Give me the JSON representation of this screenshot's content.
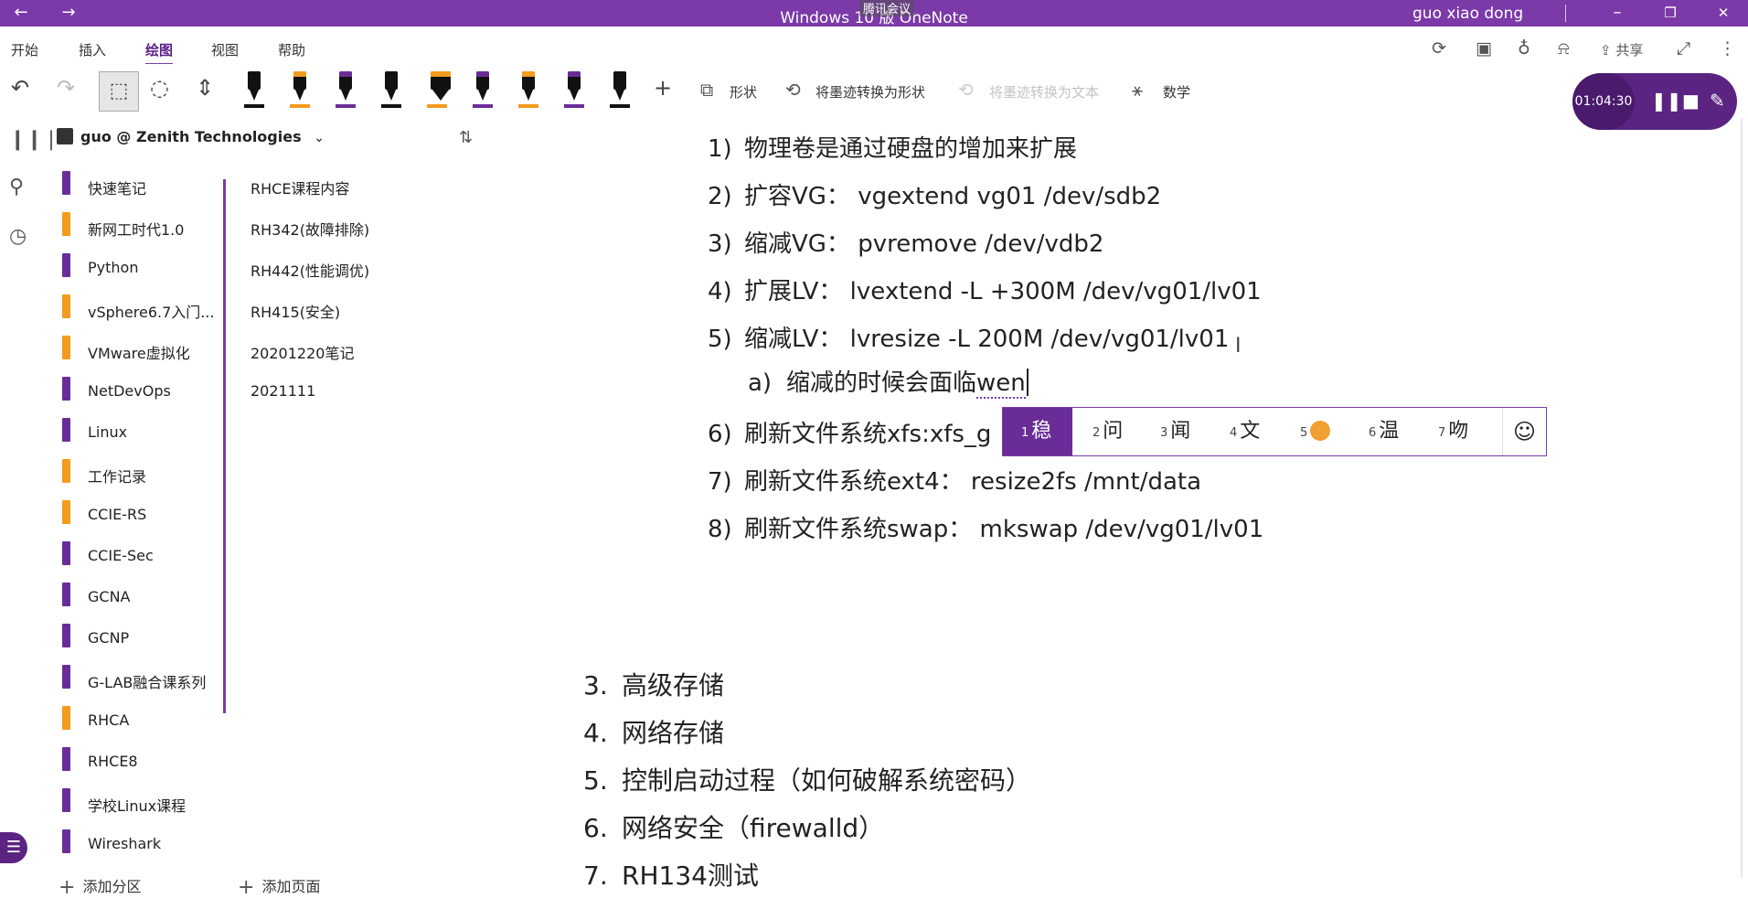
{
  "titlebar": {
    "title": "Windows 10 版 OneNote",
    "meeting_label": "腾讯会议",
    "user": "guo xiao dong",
    "back_icon": "←",
    "forward_icon": "→",
    "minimize_icon": "–",
    "restore_icon": "❐",
    "close_icon": "✕"
  },
  "menu": {
    "tabs": [
      "开始",
      "插入",
      "绘图",
      "视图",
      "帮助"
    ],
    "active_tab": "绘图",
    "share_label": "共享"
  },
  "ribbon": {
    "shapes_label": "形状",
    "ink_to_shape_label": "将墨迹转换为形状",
    "ink_to_text_label": "将墨迹转换为文本",
    "math_label": "数学",
    "pen_colors": [
      "#111111",
      "#f39b1e",
      "#6a2d97",
      "#111111",
      "#f39b1e",
      "#6a2d97",
      "#f39b1e",
      "#6a2d97",
      "#111111"
    ]
  },
  "timer": {
    "elapsed": "01:04:30"
  },
  "notebook": {
    "name": "guo @ Zenith Technologies",
    "sections": [
      {
        "name": "快速笔记",
        "color": "#6a2d97"
      },
      {
        "name": "新网工时代1.0",
        "color": "#f39b1e"
      },
      {
        "name": "Python",
        "color": "#6a2d97"
      },
      {
        "name": "vSphere6.7入门...",
        "color": "#f39b1e"
      },
      {
        "name": "VMware虚拟化",
        "color": "#f39b1e"
      },
      {
        "name": "NetDevOps",
        "color": "#6a2d97"
      },
      {
        "name": "Linux",
        "color": "#6a2d97"
      },
      {
        "name": "工作记录",
        "color": "#f39b1e"
      },
      {
        "name": "CCIE-RS",
        "color": "#f39b1e"
      },
      {
        "name": "CCIE-Sec",
        "color": "#6a2d97"
      },
      {
        "name": "GCNA",
        "color": "#6a2d97"
      },
      {
        "name": "GCNP",
        "color": "#6a2d97"
      },
      {
        "name": "G-LAB融合课系列",
        "color": "#6a2d97"
      },
      {
        "name": "RHCA",
        "color": "#f39b1e"
      },
      {
        "name": "RHCE8",
        "color": "#6a2d97"
      },
      {
        "name": "学校Linux课程",
        "color": "#6a2d97"
      },
      {
        "name": "Wireshark",
        "color": "#6a2d97"
      }
    ],
    "pages": [
      "RHCE课程内容",
      "RH342(故障排除)",
      "RH442(性能调优)",
      "RH415(安全)",
      "20201220笔记",
      "2021111"
    ],
    "add_section_label": "添加分区",
    "add_page_label": "添加页面"
  },
  "note": {
    "lines": [
      {
        "num": "1)",
        "text": "物理卷是通过硬盘的增加来扩展"
      },
      {
        "num": "2)",
        "text": "扩容VG： vgextend vg01 /dev/sdb2"
      },
      {
        "num": "3)",
        "text": "缩减VG： pvremove /dev/vdb2"
      },
      {
        "num": "4)",
        "text": "扩展LV： lvextend -L +300M /dev/vg01/lv01"
      },
      {
        "num": "5)",
        "text": "缩减LV： lvresize -L 200M /dev/vg01/lv01"
      },
      {
        "num": "6)",
        "text": "刷新文件系统xfs:xfs_g"
      },
      {
        "num": "7)",
        "text": "刷新文件系统ext4： resize2fs /mnt/data"
      },
      {
        "num": "8)",
        "text": "刷新文件系统swap： mkswap /dev/vg01/lv01"
      }
    ],
    "sub_item": {
      "num": "a)",
      "text": "缩减的时候会面临",
      "composing": "wen"
    },
    "outline": [
      {
        "num": "3.",
        "text": "高级存储"
      },
      {
        "num": "4.",
        "text": "网络存储"
      },
      {
        "num": "5.",
        "text": "控制启动过程（如何破解系统密码）"
      },
      {
        "num": "6.",
        "text": "网络安全（firewalld）"
      },
      {
        "num": "7.",
        "text": "RH134测试"
      }
    ]
  },
  "ime": {
    "candidates": [
      {
        "idx": "1",
        "text": "稳"
      },
      {
        "idx": "2",
        "text": "问"
      },
      {
        "idx": "3",
        "text": "闻"
      },
      {
        "idx": "4",
        "text": "文"
      },
      {
        "idx": "5",
        "text": ""
      },
      {
        "idx": "6",
        "text": "温"
      },
      {
        "idx": "7",
        "text": "吻"
      }
    ],
    "emoji_icon": "☺"
  }
}
